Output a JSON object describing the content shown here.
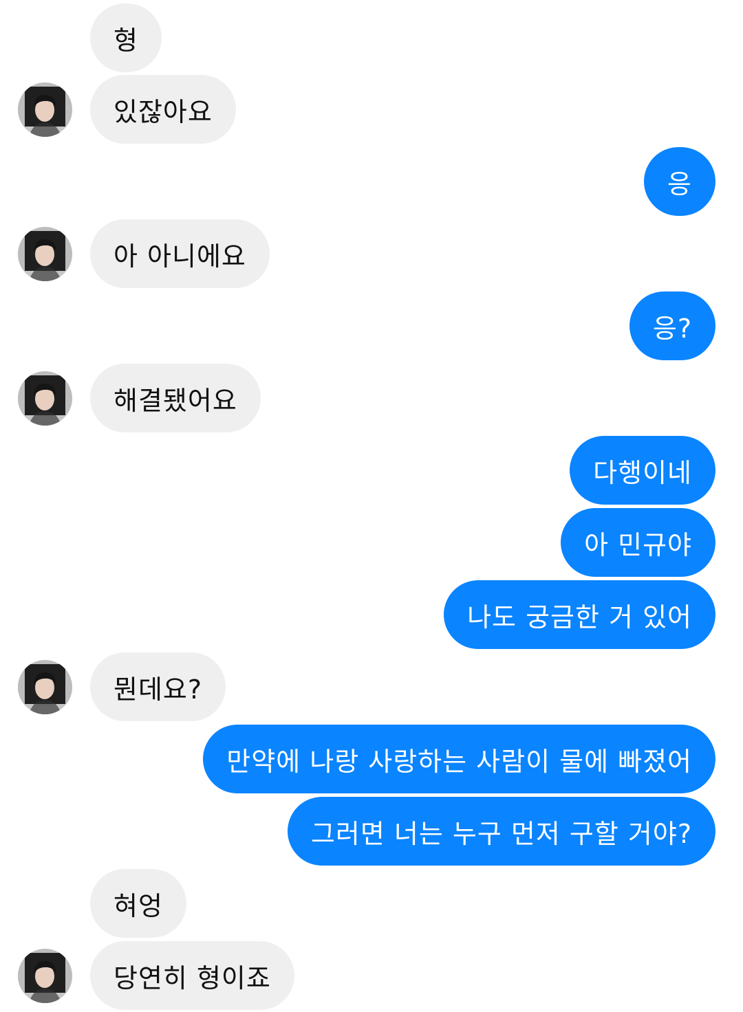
{
  "colors": {
    "sent_bubble": "#0a84ff",
    "received_bubble": "#efefef",
    "background": "#ffffff"
  },
  "contact": {
    "avatar_icon": "profile-photo"
  },
  "messages": [
    {
      "sender": "them",
      "text": "형",
      "avatar": false
    },
    {
      "sender": "them",
      "text": "있잖아요",
      "avatar": true
    },
    {
      "sender": "me",
      "text": "응"
    },
    {
      "sender": "them",
      "text": "아 아니에요",
      "avatar": true
    },
    {
      "sender": "me",
      "text": "응?"
    },
    {
      "sender": "them",
      "text": "해결됐어요",
      "avatar": true
    },
    {
      "sender": "me",
      "text": "다행이네"
    },
    {
      "sender": "me",
      "text": "아 민규야"
    },
    {
      "sender": "me",
      "text": "나도 궁금한 거 있어"
    },
    {
      "sender": "them",
      "text": "뭔데요?",
      "avatar": true
    },
    {
      "sender": "me",
      "text": "만약에 나랑 사랑하는 사람이 물에 빠졌어"
    },
    {
      "sender": "me",
      "text": "그러면 너는 누구 먼저 구할 거야?"
    },
    {
      "sender": "them",
      "text": "혀엉",
      "avatar": false
    },
    {
      "sender": "them",
      "text": "당연히 형이죠",
      "avatar": true
    }
  ]
}
